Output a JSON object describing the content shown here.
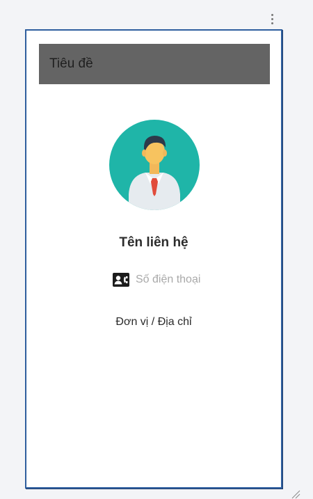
{
  "header": {
    "title": "Tiêu đề"
  },
  "contact": {
    "name": "Tên liên hệ",
    "phone_placeholder": "Số điện thoại",
    "phone_value": "",
    "address": "Đơn vị / Địa chỉ"
  },
  "icons": {
    "overflow": "more-vert-icon",
    "avatar": "person-avatar-icon",
    "phone": "contact-card-icon",
    "resize": "resize-grip-icon"
  },
  "colors": {
    "title_bar": "#646464",
    "avatar_bg": "#1fb5a8",
    "window_border": "#2e5e9e",
    "tie": "#e14c3b"
  }
}
